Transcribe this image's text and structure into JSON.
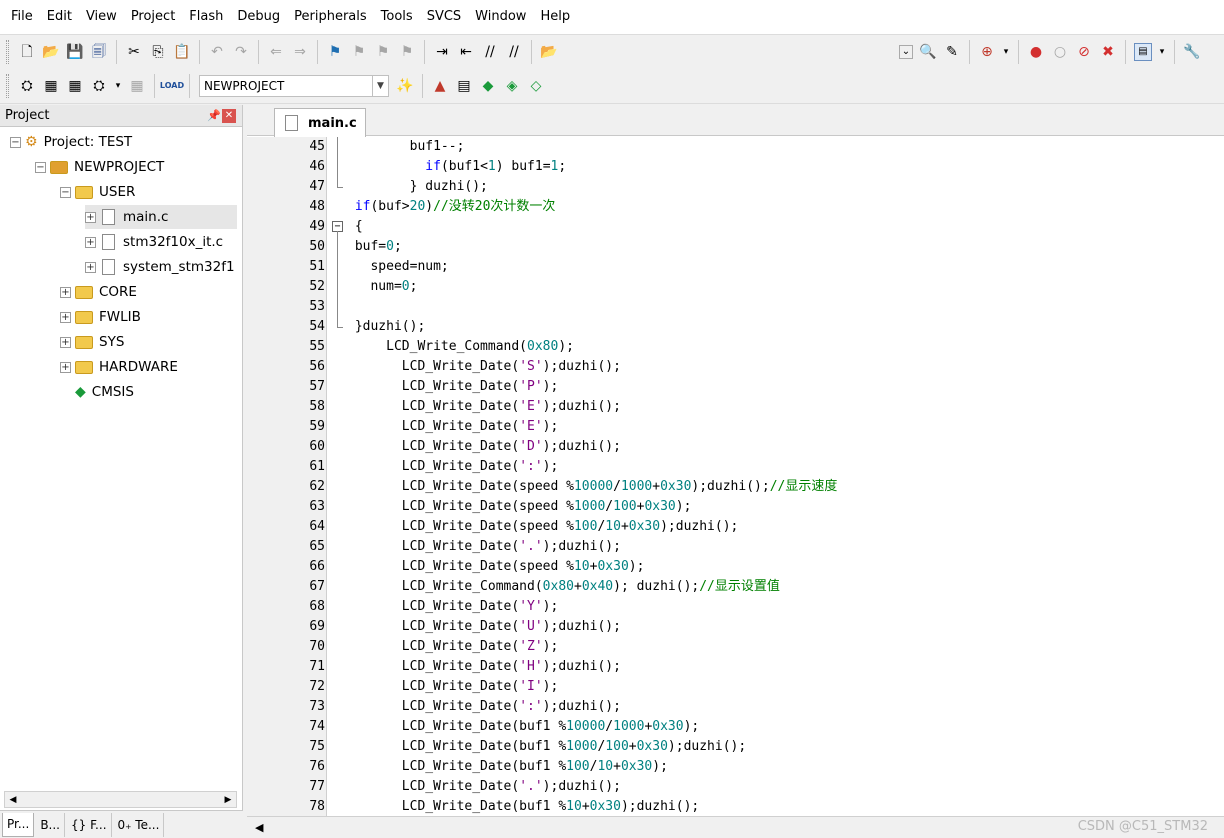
{
  "menu": [
    "File",
    "Edit",
    "View",
    "Project",
    "Flash",
    "Debug",
    "Peripherals",
    "Tools",
    "SVCS",
    "Window",
    "Help"
  ],
  "toolbar": {
    "target_name": "NEWPROJECT"
  },
  "project_panel": {
    "title": "Project",
    "tree": [
      {
        "label": "Project: TEST",
        "level": 0,
        "type": "project",
        "expander": "minus"
      },
      {
        "label": "NEWPROJECT",
        "level": 1,
        "type": "target",
        "expander": "minus"
      },
      {
        "label": "USER",
        "level": 2,
        "type": "folder",
        "expander": "minus"
      },
      {
        "label": "main.c",
        "level": 3,
        "type": "file",
        "expander": "plus",
        "selected": true
      },
      {
        "label": "stm32f10x_it.c",
        "level": 3,
        "type": "file",
        "expander": "plus"
      },
      {
        "label": "system_stm32f1",
        "level": 3,
        "type": "file",
        "expander": "plus"
      },
      {
        "label": "CORE",
        "level": 2,
        "type": "folder",
        "expander": "plus"
      },
      {
        "label": "FWLIB",
        "level": 2,
        "type": "folder",
        "expander": "plus"
      },
      {
        "label": "SYS",
        "level": 2,
        "type": "folder",
        "expander": "plus"
      },
      {
        "label": "HARDWARE",
        "level": 2,
        "type": "folder",
        "expander": "plus"
      },
      {
        "label": "CMSIS",
        "level": 2,
        "type": "cmsis",
        "expander": "none"
      }
    ],
    "tabs": [
      "Pr...",
      "B...",
      "{} F...",
      "0₊ Te..."
    ]
  },
  "editor": {
    "active_tab": "main.c",
    "lines": [
      {
        "n": "45",
        "t": "        buf1--;",
        "fold": "line"
      },
      {
        "n": "46",
        "t": "          if(buf1<1) buf1=1;",
        "fold": "line"
      },
      {
        "n": "47",
        "t": "        } duzhi();",
        "fold": "end"
      },
      {
        "n": "48",
        "t": " if(buf>20)//没转20次计数一次",
        "fold": "none"
      },
      {
        "n": "49",
        "t": " {",
        "fold": "start"
      },
      {
        "n": "50",
        "t": " buf=0;",
        "fold": "line"
      },
      {
        "n": "51",
        "t": "   speed=num;",
        "fold": "line"
      },
      {
        "n": "52",
        "t": "   num=0;",
        "fold": "line"
      },
      {
        "n": "53",
        "t": "",
        "fold": "line"
      },
      {
        "n": "54",
        "t": " }duzhi();",
        "fold": "end"
      },
      {
        "n": "55",
        "t": "     LCD_Write_Command(0x80);",
        "fold": "none"
      },
      {
        "n": "56",
        "t": "       LCD_Write_Date('S');duzhi();",
        "fold": "none"
      },
      {
        "n": "57",
        "t": "       LCD_Write_Date('P');",
        "fold": "none"
      },
      {
        "n": "58",
        "t": "       LCD_Write_Date('E');duzhi();",
        "fold": "none"
      },
      {
        "n": "59",
        "t": "       LCD_Write_Date('E');",
        "fold": "none"
      },
      {
        "n": "60",
        "t": "       LCD_Write_Date('D');duzhi();",
        "fold": "none"
      },
      {
        "n": "61",
        "t": "       LCD_Write_Date(':');",
        "fold": "none"
      },
      {
        "n": "62",
        "t": "       LCD_Write_Date(speed %10000/1000+0x30);duzhi();//显示速度",
        "fold": "none"
      },
      {
        "n": "63",
        "t": "       LCD_Write_Date(speed %1000/100+0x30);",
        "fold": "none"
      },
      {
        "n": "64",
        "t": "       LCD_Write_Date(speed %100/10+0x30);duzhi();",
        "fold": "none"
      },
      {
        "n": "65",
        "t": "       LCD_Write_Date('.');duzhi();",
        "fold": "none"
      },
      {
        "n": "66",
        "t": "       LCD_Write_Date(speed %10+0x30);",
        "fold": "none"
      },
      {
        "n": "67",
        "t": "       LCD_Write_Command(0x80+0x40); duzhi();//显示设置值",
        "fold": "none"
      },
      {
        "n": "68",
        "t": "       LCD_Write_Date('Y');",
        "fold": "none"
      },
      {
        "n": "69",
        "t": "       LCD_Write_Date('U');duzhi();",
        "fold": "none"
      },
      {
        "n": "70",
        "t": "       LCD_Write_Date('Z');",
        "fold": "none"
      },
      {
        "n": "71",
        "t": "       LCD_Write_Date('H');duzhi();",
        "fold": "none"
      },
      {
        "n": "72",
        "t": "       LCD_Write_Date('I');",
        "fold": "none"
      },
      {
        "n": "73",
        "t": "       LCD_Write_Date(':');duzhi();",
        "fold": "none"
      },
      {
        "n": "74",
        "t": "       LCD_Write_Date(buf1 %10000/1000+0x30);",
        "fold": "none"
      },
      {
        "n": "75",
        "t": "       LCD_Write_Date(buf1 %1000/100+0x30);duzhi();",
        "fold": "none"
      },
      {
        "n": "76",
        "t": "       LCD_Write_Date(buf1 %100/10+0x30);",
        "fold": "none"
      },
      {
        "n": "77",
        "t": "       LCD_Write_Date('.');duzhi();",
        "fold": "none"
      },
      {
        "n": "78",
        "t": "       LCD_Write_Date(buf1 %10+0x30);duzhi();",
        "fold": "none"
      }
    ]
  },
  "watermark": "CSDN @C51_STM32"
}
